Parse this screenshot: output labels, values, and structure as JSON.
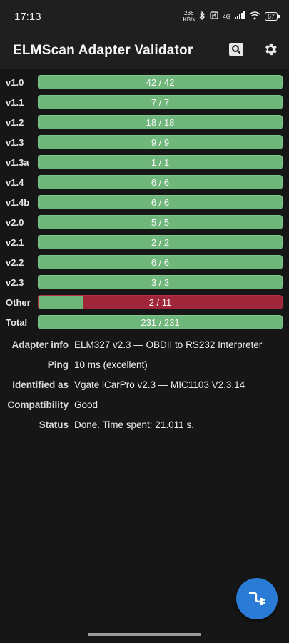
{
  "status_bar": {
    "time": "17:13",
    "net_speed_value": "236",
    "net_speed_unit": "KB/s",
    "network_type": "4G",
    "battery": "67"
  },
  "app_bar": {
    "title": "ELMScan Adapter Validator",
    "search_icon": "search-icon",
    "settings_icon": "gear-icon"
  },
  "results": [
    {
      "label": "v1.0",
      "text": "42 / 42",
      "passed": 42,
      "total": 42
    },
    {
      "label": "v1.1",
      "text": "7 / 7",
      "passed": 7,
      "total": 7
    },
    {
      "label": "v1.2",
      "text": "18 / 18",
      "passed": 18,
      "total": 18
    },
    {
      "label": "v1.3",
      "text": "9 / 9",
      "passed": 9,
      "total": 9
    },
    {
      "label": "v1.3a",
      "text": "1 / 1",
      "passed": 1,
      "total": 1
    },
    {
      "label": "v1.4",
      "text": "6 / 6",
      "passed": 6,
      "total": 6
    },
    {
      "label": "v1.4b",
      "text": "6 / 6",
      "passed": 6,
      "total": 6
    },
    {
      "label": "v2.0",
      "text": "5 / 5",
      "passed": 5,
      "total": 5
    },
    {
      "label": "v2.1",
      "text": "2 / 2",
      "passed": 2,
      "total": 2
    },
    {
      "label": "v2.2",
      "text": "6 / 6",
      "passed": 6,
      "total": 6
    },
    {
      "label": "v2.3",
      "text": "3 / 3",
      "passed": 3,
      "total": 3
    },
    {
      "label": "Other",
      "text": "2 / 11",
      "passed": 2,
      "total": 11
    },
    {
      "label": "Total",
      "text": "231 / 231",
      "passed": 231,
      "total": 231
    }
  ],
  "info": [
    {
      "key": "Adapter info",
      "value": "ELM327 v2.3 — OBDII to RS232 Interpreter"
    },
    {
      "key": "Ping",
      "value": "10 ms (excellent)"
    },
    {
      "key": "Identified as",
      "value": "Vgate iCarPro v2.3 — MIC1103 V2.3.14"
    },
    {
      "key": "Compatibility",
      "value": "Good"
    },
    {
      "key": "Status",
      "value": "Done. Time spent: 21.011 s."
    }
  ],
  "fab": {
    "icon": "connect-plug-icon"
  },
  "colors": {
    "pass": "#6fb67a",
    "fail": "#a0273a",
    "accent": "#2a7bd6"
  }
}
